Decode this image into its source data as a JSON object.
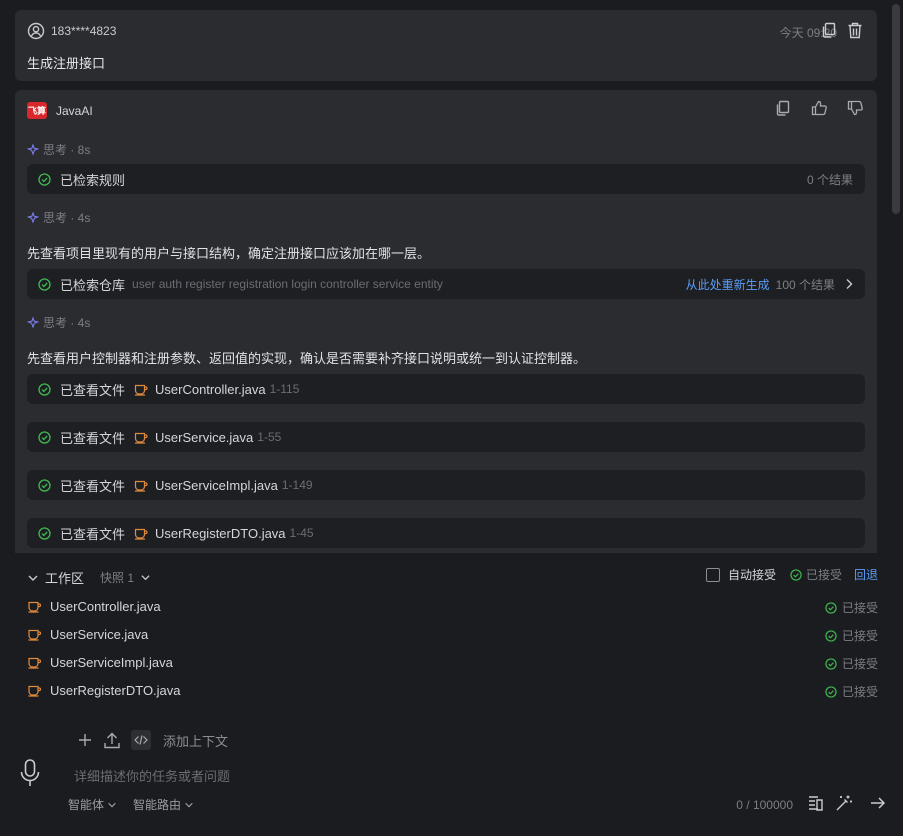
{
  "user_card": {
    "phone": "183****4823",
    "time": "今天 09:20",
    "message": "生成注册接口"
  },
  "ai_card": {
    "name": "JavaAI",
    "logo_text": "飞算",
    "think1": "思考 · 8s",
    "step_rules": {
      "label": "已检索规则",
      "result": "0 个结果"
    },
    "think2": "思考 · 4s",
    "para1": "先查看项目里现有的用户与接口结构，确定注册接口应该加在哪一层。",
    "step_repo": {
      "label": "已检索仓库",
      "query": "user auth register registration login controller service entity",
      "regen": "从此处重新生成",
      "result": "100 个结果"
    },
    "think3": "思考 · 4s",
    "para2": "先查看用户控制器和注册参数、返回值的实现，确认是否需要补齐接口说明或统一到认证控制器。",
    "file_steps": [
      {
        "label": "已查看文件",
        "file": "UserController.java",
        "range": "1-115"
      },
      {
        "label": "已查看文件",
        "file": "UserService.java",
        "range": "1-55"
      },
      {
        "label": "已查看文件",
        "file": "UserServiceImpl.java",
        "range": "1-149"
      },
      {
        "label": "已查看文件",
        "file": "UserRegisterDTO.java",
        "range": "1-45"
      }
    ]
  },
  "workspace": {
    "title": "工作区",
    "snapshot": "快照 1",
    "auto_accept": "自动接受",
    "accepted": "已接受",
    "rollback": "回退",
    "files": [
      {
        "name": "UserController.java",
        "status": "已接受"
      },
      {
        "name": "UserService.java",
        "status": "已接受"
      },
      {
        "name": "UserServiceImpl.java",
        "status": "已接受"
      },
      {
        "name": "UserRegisterDTO.java",
        "status": "已接受"
      }
    ]
  },
  "composer": {
    "add_context": "添加上下文",
    "placeholder": "详细描述你的任务或者问题",
    "mode": "智能体",
    "routing": "智能路由",
    "counter": "0 / 100000"
  },
  "colors": {
    "accent": "#5b9cf5",
    "success": "#3fb950",
    "file_icon": "#e08a3c",
    "logo": "#d8282c"
  }
}
